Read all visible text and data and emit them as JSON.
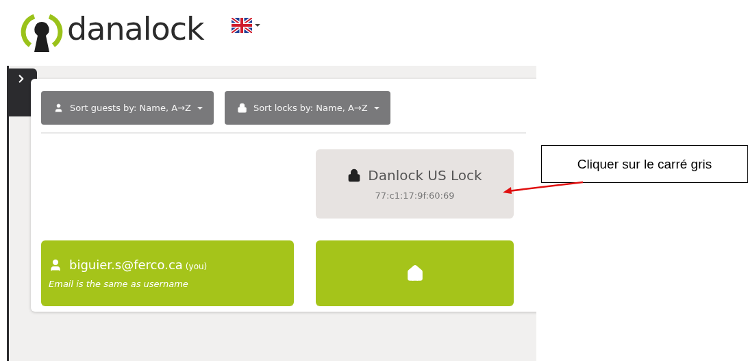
{
  "header": {
    "logo_text": "danalock"
  },
  "sort_buttons": [
    {
      "kind": "guests",
      "label": "Sort guests by: Name, A→Z"
    },
    {
      "kind": "locks",
      "label": "Sort locks by: Name, A→Z"
    }
  ],
  "lock": {
    "name": "Danlock US Lock",
    "mac": "77:c1:17:9f:60:69"
  },
  "user": {
    "email": "biguier.s@ferco.ca",
    "tag": "(you)",
    "note": "Email is the same as username"
  },
  "annotation": {
    "text": "Cliquer sur le carré gris"
  }
}
